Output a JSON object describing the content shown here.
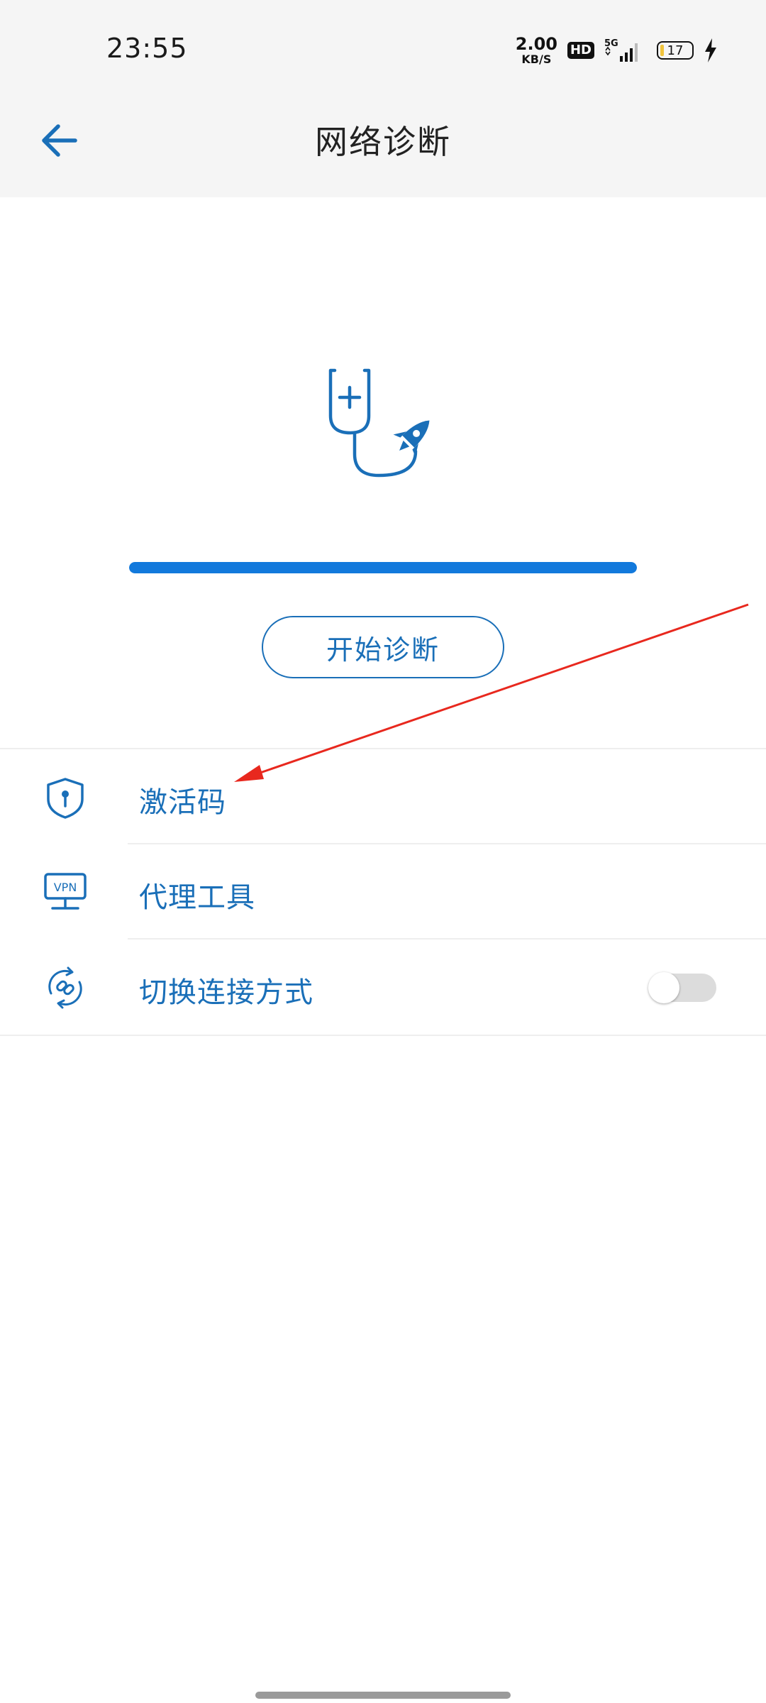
{
  "status_bar": {
    "time": "23:55",
    "net_speed_value": "2.00",
    "net_speed_unit": "KB/S",
    "hd_badge": "HD",
    "network_type": "5G",
    "battery_level": "17"
  },
  "header": {
    "title": "网络诊断",
    "back_icon": "arrow-left-icon"
  },
  "diagnosis": {
    "hero_icon": "stethoscope-rocket-icon",
    "progress": 1.0,
    "start_button_label": "开始诊断"
  },
  "list": {
    "items": [
      {
        "label": "激活码",
        "icon": "shield-key-icon",
        "has_toggle": false
      },
      {
        "label": "代理工具",
        "icon": "vpn-icon",
        "has_toggle": false
      },
      {
        "label": "切换连接方式",
        "icon": "link-switch-icon",
        "has_toggle": true,
        "toggle_on": false
      }
    ]
  },
  "colors": {
    "accent": "#1279dc",
    "text_accent": "#1a6fb8",
    "header_bg": "#f5f5f5",
    "annotation": "#e8281e"
  }
}
